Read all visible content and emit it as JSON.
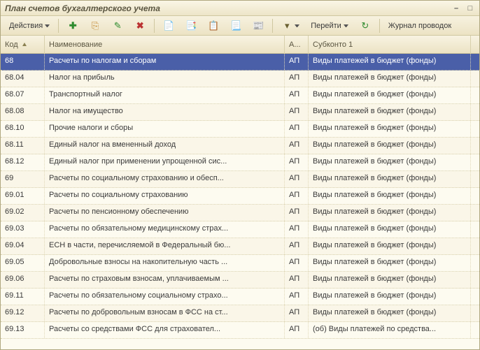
{
  "window": {
    "title": "План счетов бухгалтерского учета"
  },
  "toolbar": {
    "actions_label": "Действия",
    "goto_label": "Перейти",
    "journal_label": "Журнал проводок"
  },
  "grid": {
    "columns": {
      "code": "Код",
      "name": "Наименование",
      "ap": "А...",
      "sub1": "Субконто 1"
    },
    "rows": [
      {
        "code": "68",
        "name": "Расчеты по налогам и сборам",
        "ap": "АП",
        "sub1": "Виды платежей в бюджет (фонды)",
        "selected": true
      },
      {
        "code": "68.04",
        "name": "Налог на прибыль",
        "ap": "АП",
        "sub1": "Виды платежей в бюджет (фонды)"
      },
      {
        "code": "68.07",
        "name": "Транспортный налог",
        "ap": "АП",
        "sub1": "Виды платежей в бюджет (фонды)"
      },
      {
        "code": "68.08",
        "name": "Налог на имущество",
        "ap": "АП",
        "sub1": "Виды платежей в бюджет (фонды)"
      },
      {
        "code": "68.10",
        "name": "Прочие налоги и сборы",
        "ap": "АП",
        "sub1": "Виды платежей в бюджет (фонды)"
      },
      {
        "code": "68.11",
        "name": "Единый налог на вмененный доход",
        "ap": "АП",
        "sub1": "Виды платежей в бюджет (фонды)"
      },
      {
        "code": "68.12",
        "name": "Единый налог при применении упрощенной сис...",
        "ap": "АП",
        "sub1": "Виды платежей в бюджет (фонды)"
      },
      {
        "code": "69",
        "name": "Расчеты по социальному страхованию и обесп...",
        "ap": "АП",
        "sub1": "Виды платежей в бюджет (фонды)"
      },
      {
        "code": "69.01",
        "name": "Расчеты по социальному страхованию",
        "ap": "АП",
        "sub1": "Виды платежей в бюджет (фонды)"
      },
      {
        "code": "69.02",
        "name": "Расчеты по пенсионному обеспечению",
        "ap": "АП",
        "sub1": "Виды платежей в бюджет (фонды)"
      },
      {
        "code": "69.03",
        "name": "Расчеты по обязательному медицинскому страх...",
        "ap": "АП",
        "sub1": "Виды платежей в бюджет (фонды)"
      },
      {
        "code": "69.04",
        "name": "ЕСН в части, перечисляемой в Федеральный бю...",
        "ap": "АП",
        "sub1": "Виды платежей в бюджет (фонды)"
      },
      {
        "code": "69.05",
        "name": "Добровольные взносы на накопительную часть ...",
        "ap": "АП",
        "sub1": "Виды платежей в бюджет (фонды)"
      },
      {
        "code": "69.06",
        "name": "Расчеты по страховым взносам, уплачиваемым ...",
        "ap": "АП",
        "sub1": "Виды платежей в бюджет (фонды)"
      },
      {
        "code": "69.11",
        "name": "Расчеты по обязательному социальному страхо...",
        "ap": "АП",
        "sub1": "Виды платежей в бюджет (фонды)"
      },
      {
        "code": "69.12",
        "name": "Расчеты по добровольным взносам в ФСС на ст...",
        "ap": "АП",
        "sub1": "Виды платежей в бюджет (фонды)"
      },
      {
        "code": "69.13",
        "name": "Расчеты со средствами ФСС для страховател...",
        "ap": "АП",
        "sub1": "(об) Виды платежей по средства..."
      }
    ]
  }
}
